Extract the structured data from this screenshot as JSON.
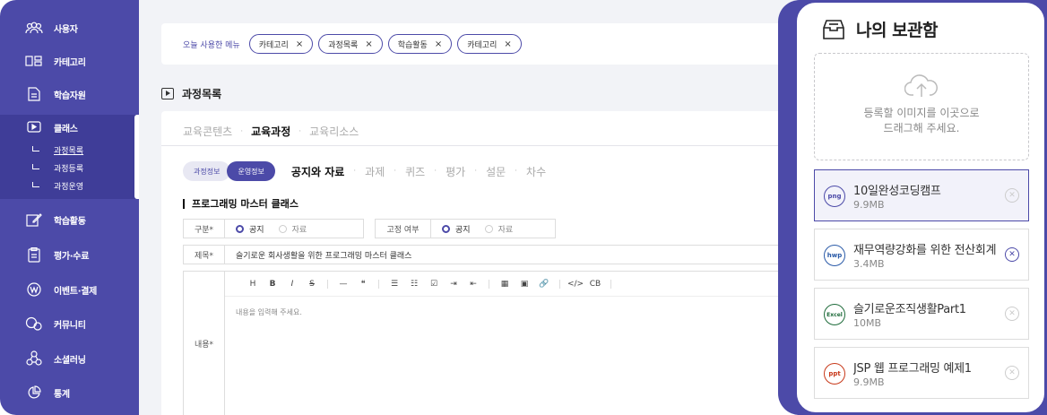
{
  "sidebar": {
    "items": [
      {
        "label": "사용자",
        "icon": "users-icon"
      },
      {
        "label": "카테고리",
        "icon": "category-icon"
      },
      {
        "label": "학습자원",
        "icon": "document-icon"
      },
      {
        "label": "클래스",
        "icon": "play-icon"
      },
      {
        "label": "학습활동",
        "icon": "edit-icon"
      },
      {
        "label": "평가·수료",
        "icon": "clipboard-icon"
      },
      {
        "label": "이벤트·결제",
        "icon": "won-icon"
      },
      {
        "label": "커뮤니티",
        "icon": "chat-icon"
      },
      {
        "label": "소셜러닝",
        "icon": "network-icon"
      },
      {
        "label": "통계",
        "icon": "pie-chart-icon"
      }
    ],
    "subitems": [
      "과정목록",
      "과정등록",
      "과정운영"
    ]
  },
  "recent": {
    "label": "오늘 사용한 메뉴",
    "chips": [
      "카테고리",
      "과정목록",
      "학습활동",
      "카테고리"
    ],
    "close": "×"
  },
  "page": {
    "title": "과정목록"
  },
  "tabs": [
    "교육콘텐츠",
    "교육과정",
    "교육리소스"
  ],
  "subtabs": {
    "pills": [
      "과정정보",
      "운영정보"
    ],
    "items": [
      "공지와 자료",
      "과제",
      "퀴즈",
      "평가",
      "설문",
      "차수"
    ]
  },
  "section": {
    "title": "프로그래밍 마스터 클래스"
  },
  "form": {
    "category_label": "구분*",
    "fixed_label": "고정 여부",
    "opt_notice": "공지",
    "opt_material": "자료",
    "title_label": "제목*",
    "title_value": "슬기로운 회사생활을 위한 프로그래밍 마스터 클래스",
    "content_label": "내용*",
    "content_placeholder": "내용을 입력해 주세요."
  },
  "toolbar": {
    "h": "H",
    "b": "B",
    "i": "I",
    "s": "S",
    "hr": "—",
    "quote": "❝",
    "ul": "☰",
    "ol": "☷",
    "task": "☑",
    "indent": "⇥",
    "outdent": "⇤",
    "table": "▦",
    "image": "▣",
    "link": "🔗",
    "code": "</>",
    "cb": "CB"
  },
  "panel": {
    "title": "나의 보관함",
    "dropzone_line1": "등록할 이미지를 이곳으로",
    "dropzone_line2": "드래그해 주세요.",
    "files": [
      {
        "type": "png",
        "name": "10일완성코딩캠프",
        "size": "9.9MB"
      },
      {
        "type": "hwp",
        "name": "재무역량강화를 위한 전산회계",
        "size": "3.4MB"
      },
      {
        "type": "Excel",
        "name": "슬기로운조직생활Part1",
        "size": "10MB"
      },
      {
        "type": "ppt",
        "name": "JSP 웹 프로그래밍 예제1",
        "size": "9.9MB"
      }
    ],
    "delete_glyph": "✕"
  },
  "colors": {
    "accent": "#4c4aa8",
    "main_bg": "#f2f3f7"
  }
}
